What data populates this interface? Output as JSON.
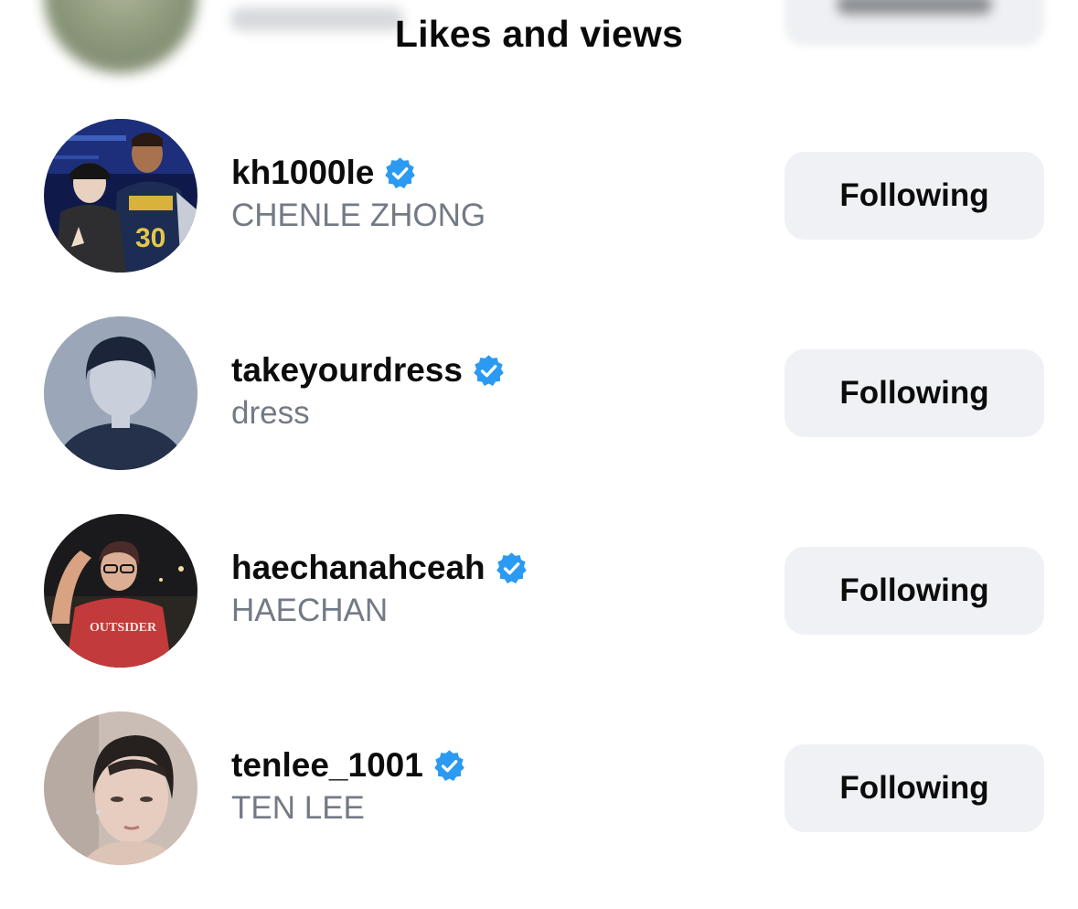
{
  "header": {
    "title": "Likes and views"
  },
  "users": [
    {
      "username": "kh1000le",
      "full_name": "CHENLE ZHONG",
      "verified": true,
      "button_label": "Following"
    },
    {
      "username": "takeyourdress",
      "full_name": "dress",
      "verified": true,
      "button_label": "Following"
    },
    {
      "username": "haechanahceah",
      "full_name": "HAECHAN",
      "verified": true,
      "button_label": "Following"
    },
    {
      "username": "tenlee_1001",
      "full_name": "TEN LEE",
      "verified": true,
      "button_label": "Following"
    }
  ],
  "colors": {
    "verified_badge": "#2a9af3",
    "button_background": "#eff1f4",
    "secondary_text": "#737a86"
  },
  "icons": {
    "verified": "verified-badge-icon"
  }
}
